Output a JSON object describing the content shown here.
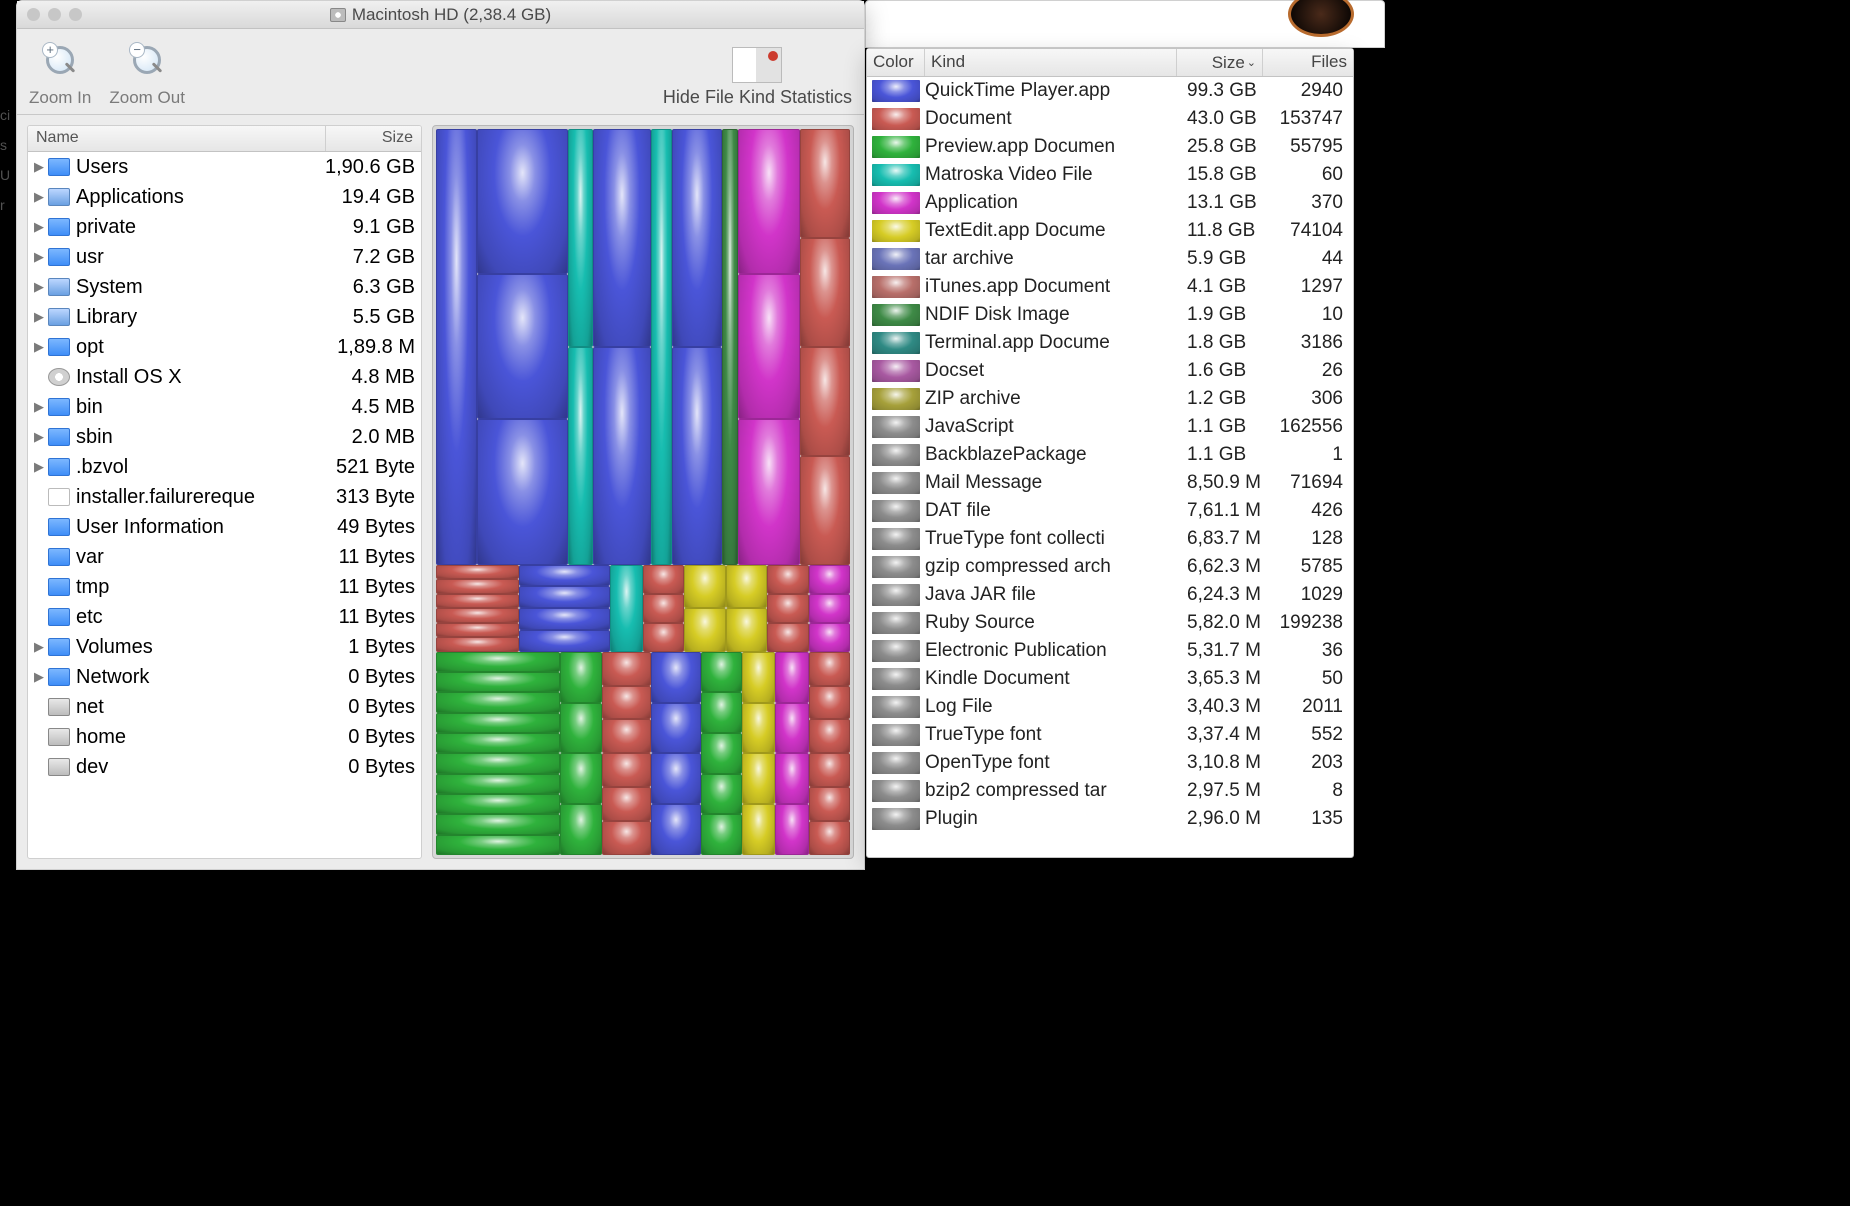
{
  "window": {
    "title": "Macintosh HD (2,38.4 GB)"
  },
  "toolbar": {
    "zoom_in": "Zoom In",
    "zoom_out": "Zoom Out",
    "hide_stats": "Hide File Kind Statistics"
  },
  "file_list": {
    "columns": {
      "name": "Name",
      "size": "Size"
    },
    "rows": [
      {
        "expand": true,
        "icon": "folder",
        "name": "Users",
        "size": "1,90.6 GB"
      },
      {
        "expand": true,
        "icon": "folder-alt",
        "name": "Applications",
        "size": "19.4 GB"
      },
      {
        "expand": true,
        "icon": "folder",
        "name": "private",
        "size": "9.1 GB"
      },
      {
        "expand": true,
        "icon": "folder",
        "name": "usr",
        "size": "7.2 GB"
      },
      {
        "expand": true,
        "icon": "folder-alt",
        "name": "System",
        "size": "6.3 GB"
      },
      {
        "expand": true,
        "icon": "folder-alt",
        "name": "Library",
        "size": "5.5 GB"
      },
      {
        "expand": true,
        "icon": "folder",
        "name": "opt",
        "size": "1,89.8 M"
      },
      {
        "expand": false,
        "icon": "pkg",
        "name": "Install OS X",
        "size": "4.8 MB"
      },
      {
        "expand": true,
        "icon": "folder",
        "name": "bin",
        "size": "4.5 MB"
      },
      {
        "expand": true,
        "icon": "folder",
        "name": "sbin",
        "size": "2.0 MB"
      },
      {
        "expand": true,
        "icon": "folder",
        "name": ".bzvol",
        "size": "521 Byte"
      },
      {
        "expand": false,
        "icon": "doc",
        "name": "installer.failurereque",
        "size": "313 Byte"
      },
      {
        "expand": false,
        "icon": "folder",
        "name": "User Information",
        "size": "49 Bytes"
      },
      {
        "expand": false,
        "icon": "folder",
        "name": "var",
        "size": "11 Bytes"
      },
      {
        "expand": false,
        "icon": "folder",
        "name": "tmp",
        "size": "11 Bytes"
      },
      {
        "expand": false,
        "icon": "folder",
        "name": "etc",
        "size": "11 Bytes"
      },
      {
        "expand": true,
        "icon": "folder",
        "name": "Volumes",
        "size": "1 Bytes"
      },
      {
        "expand": true,
        "icon": "folder",
        "name": "Network",
        "size": "0 Bytes"
      },
      {
        "expand": false,
        "icon": "drive",
        "name": "net",
        "size": "0 Bytes"
      },
      {
        "expand": false,
        "icon": "drive",
        "name": "home",
        "size": "0 Bytes"
      },
      {
        "expand": false,
        "icon": "drive",
        "name": "dev",
        "size": "0 Bytes"
      }
    ]
  },
  "stats": {
    "columns": {
      "color": "Color",
      "kind": "Kind",
      "size": "Size",
      "files": "Files"
    },
    "rows": [
      {
        "color": "#4a55d8",
        "kind": "QuickTime Player.app",
        "size": "99.3 GB",
        "files": "2940"
      },
      {
        "color": "#c95a53",
        "kind": "Document",
        "size": "43.0 GB",
        "files": "153747"
      },
      {
        "color": "#2fb23c",
        "kind": "Preview.app Documen",
        "size": "25.8 GB",
        "files": "55795"
      },
      {
        "color": "#17bdb0",
        "kind": "Matroska Video File",
        "size": "15.8 GB",
        "files": "60"
      },
      {
        "color": "#d134c9",
        "kind": "Application",
        "size": "13.1 GB",
        "files": "370"
      },
      {
        "color": "#d6cc25",
        "kind": "TextEdit.app Docume",
        "size": "11.8 GB",
        "files": "74104"
      },
      {
        "color": "#6a73b8",
        "kind": "tar archive",
        "size": "5.9 GB",
        "files": "44"
      },
      {
        "color": "#b86f6a",
        "kind": "iTunes.app Document",
        "size": "4.1 GB",
        "files": "1297"
      },
      {
        "color": "#3e8a46",
        "kind": "NDIF Disk Image",
        "size": "1.9 GB",
        "files": "10"
      },
      {
        "color": "#2f8a84",
        "kind": "Terminal.app Docume",
        "size": "1.8 GB",
        "files": "3186"
      },
      {
        "color": "#a859a1",
        "kind": "Docset",
        "size": "1.6 GB",
        "files": "26"
      },
      {
        "color": "#a6a03a",
        "kind": "ZIP archive",
        "size": "1.2 GB",
        "files": "306"
      },
      {
        "color": "#8c8c8c",
        "kind": "JavaScript",
        "size": "1.1 GB",
        "files": "162556"
      },
      {
        "color": "#8c8c8c",
        "kind": "BackblazePackage",
        "size": "1.1 GB",
        "files": "1"
      },
      {
        "color": "#8c8c8c",
        "kind": "Mail Message",
        "size": "8,50.9 M",
        "files": "71694"
      },
      {
        "color": "#8c8c8c",
        "kind": "DAT file",
        "size": "7,61.1 M",
        "files": "426"
      },
      {
        "color": "#8c8c8c",
        "kind": "TrueType font collecti",
        "size": "6,83.7 M",
        "files": "128"
      },
      {
        "color": "#8c8c8c",
        "kind": "gzip compressed arch",
        "size": "6,62.3 M",
        "files": "5785"
      },
      {
        "color": "#8c8c8c",
        "kind": "Java JAR file",
        "size": "6,24.3 M",
        "files": "1029"
      },
      {
        "color": "#8c8c8c",
        "kind": "Ruby Source",
        "size": "5,82.0 M",
        "files": "199238"
      },
      {
        "color": "#8c8c8c",
        "kind": "Electronic Publication",
        "size": "5,31.7 M",
        "files": "36"
      },
      {
        "color": "#8c8c8c",
        "kind": "Kindle Document",
        "size": "3,65.3 M",
        "files": "50"
      },
      {
        "color": "#8c8c8c",
        "kind": "Log File",
        "size": "3,40.3 M",
        "files": "2011"
      },
      {
        "color": "#8c8c8c",
        "kind": "TrueType font",
        "size": "3,37.4 M",
        "files": "552"
      },
      {
        "color": "#8c8c8c",
        "kind": "OpenType font",
        "size": "3,10.8 M",
        "files": "203"
      },
      {
        "color": "#8c8c8c",
        "kind": "bzip2 compressed tar",
        "size": "2,97.5 M",
        "files": "8"
      },
      {
        "color": "#8c8c8c",
        "kind": "Plugin",
        "size": "2,96.0 M",
        "files": "135"
      }
    ]
  },
  "treemap_colors": {
    "qt": "#4a55d8",
    "doc": "#c95a53",
    "prv": "#2fb23c",
    "mkv": "#17bdb0",
    "app": "#d134c9",
    "txt": "#d6cc25",
    "tar": "#6a73b8",
    "itu": "#b86f6a",
    "ndi": "#3e8a46",
    "trm": "#2f8a84"
  }
}
